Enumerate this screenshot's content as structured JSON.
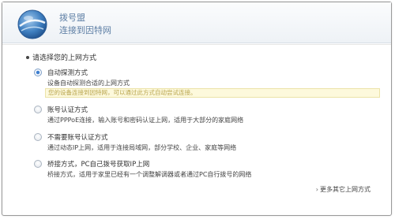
{
  "header": {
    "title": "拨号盟",
    "subtitle": "连接到因特网"
  },
  "prompt": "请选择您的上网方式",
  "options": [
    {
      "title": "自动探测方式",
      "desc": "设备自动探测合适的上网方式",
      "note": "您的设备连接到因特网，可以通过此方式自动尝试连接。",
      "selected": true
    },
    {
      "title": "账号认证方式",
      "desc": "通过PPPoE连接，输入账号和密码认证上网，适用于大部分的家庭网络",
      "selected": false
    },
    {
      "title": "不需要账号认证方式",
      "desc": "通过动态IP上网，适用于连接局域网，部分学校、企业、家庭等网络",
      "selected": false
    },
    {
      "title": "桥接方式，PC自己拨号获取IP上网",
      "desc": "桥接方式，适用于家里已经有一个调整解调器或者通过PC自行拨号的网络",
      "selected": false
    }
  ],
  "more_link": "更多其它上网方式",
  "colors": {
    "title": "#5e7fa5",
    "radio_selected": "#3e7fd0",
    "note_bg": "#fdf9dc",
    "note_text": "#b8a44d"
  },
  "icons": {
    "logo": "globe-logo-icon",
    "more": "chevron-right-icon"
  }
}
